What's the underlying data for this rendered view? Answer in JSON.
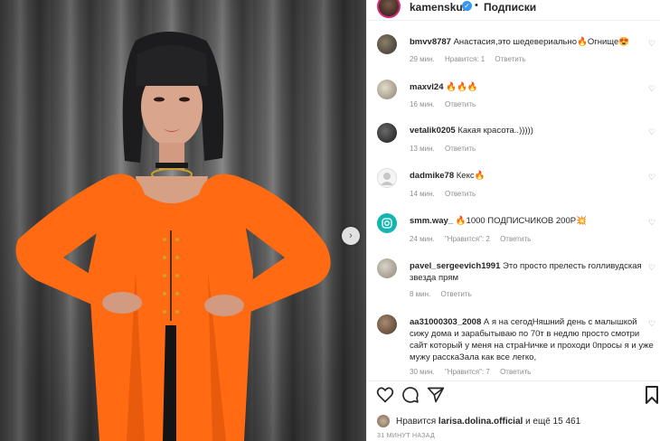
{
  "post": {
    "username": "kamenskux",
    "separator": "•",
    "follow_label": "Подписки"
  },
  "comments": [
    {
      "user": "bmvv8787",
      "text": "Анастасия,это шедевериально🔥Огнище😍",
      "time": "29 мин.",
      "likes": "Нравится: 1",
      "reply": "Ответить"
    },
    {
      "user": "maxvl24",
      "text": "🔥🔥🔥",
      "time": "16 мин.",
      "reply": "Ответить"
    },
    {
      "user": "vetalik0205",
      "text": "Какая красота..)))))",
      "time": "13 мин.",
      "reply": "Ответить"
    },
    {
      "user": "dadmike78",
      "text": "Кекс🔥",
      "time": "14 мин.",
      "reply": "Ответить"
    },
    {
      "user": "smm.way_",
      "text": "🔥1000 ПОДПИСЧИКОВ 200Р💥",
      "time": "24 мин.",
      "likes": "\"Нравится\": 2",
      "reply": "Ответить"
    },
    {
      "user": "pavel_sergeevich1991",
      "text": "Это просто прелесть голливудская звезда прям",
      "time": "8 мин.",
      "reply": "Ответить"
    },
    {
      "user": "aa31000303_2008",
      "text": "А я на сегодНяшний день с малышкой сижу дома и зарабытываю по 70т в недлю просто смотри сайт который у меня на страНичке и проходи 0просы я и уже мужу расскаЗала как все легко,",
      "time": "30 мин.",
      "likes": "\"Нравится\": 7",
      "reply": "Ответить"
    }
  ],
  "footer": {
    "likes_prefix": "Нравится",
    "likes_user": "larisa.dolina.official",
    "likes_suffix": "и ещё 15 461",
    "time_ago": "31 МИНУТ НАЗАД"
  },
  "colors": {
    "accent": "#3897f0",
    "dress": "#ff6a13",
    "muted": "#8e8e8e"
  },
  "icons": [
    "verified-badge-icon",
    "heart-icon",
    "comment-icon",
    "share-icon",
    "bookmark-icon",
    "chevron-right-icon"
  ]
}
